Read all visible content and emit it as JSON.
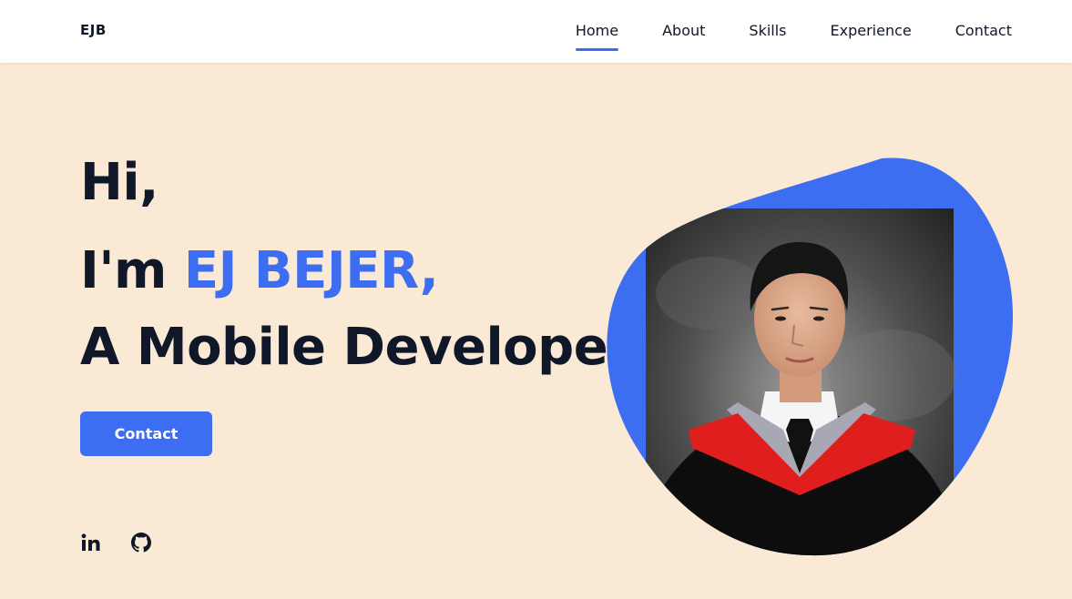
{
  "nav": {
    "logo": "EJB",
    "items": [
      {
        "label": "Home",
        "active": true
      },
      {
        "label": "About",
        "active": false
      },
      {
        "label": "Skills",
        "active": false
      },
      {
        "label": "Experience",
        "active": false
      },
      {
        "label": "Contact",
        "active": false
      }
    ]
  },
  "hero": {
    "greeting": "Hi,",
    "intro_prefix": "I'm ",
    "name": "EJ BEJER,",
    "role": "A Mobile Developer",
    "contact_button": "Contact"
  },
  "social": [
    {
      "icon": "linkedin-icon",
      "label": "in"
    },
    {
      "icon": "github-icon"
    }
  ],
  "image": {
    "icon": "profile-photo",
    "description_visible": false
  },
  "colors": {
    "background": "#FAEAD5",
    "navbar": "#FFFFFF",
    "accent": "#3D6DF0",
    "text": "#0F1729"
  }
}
